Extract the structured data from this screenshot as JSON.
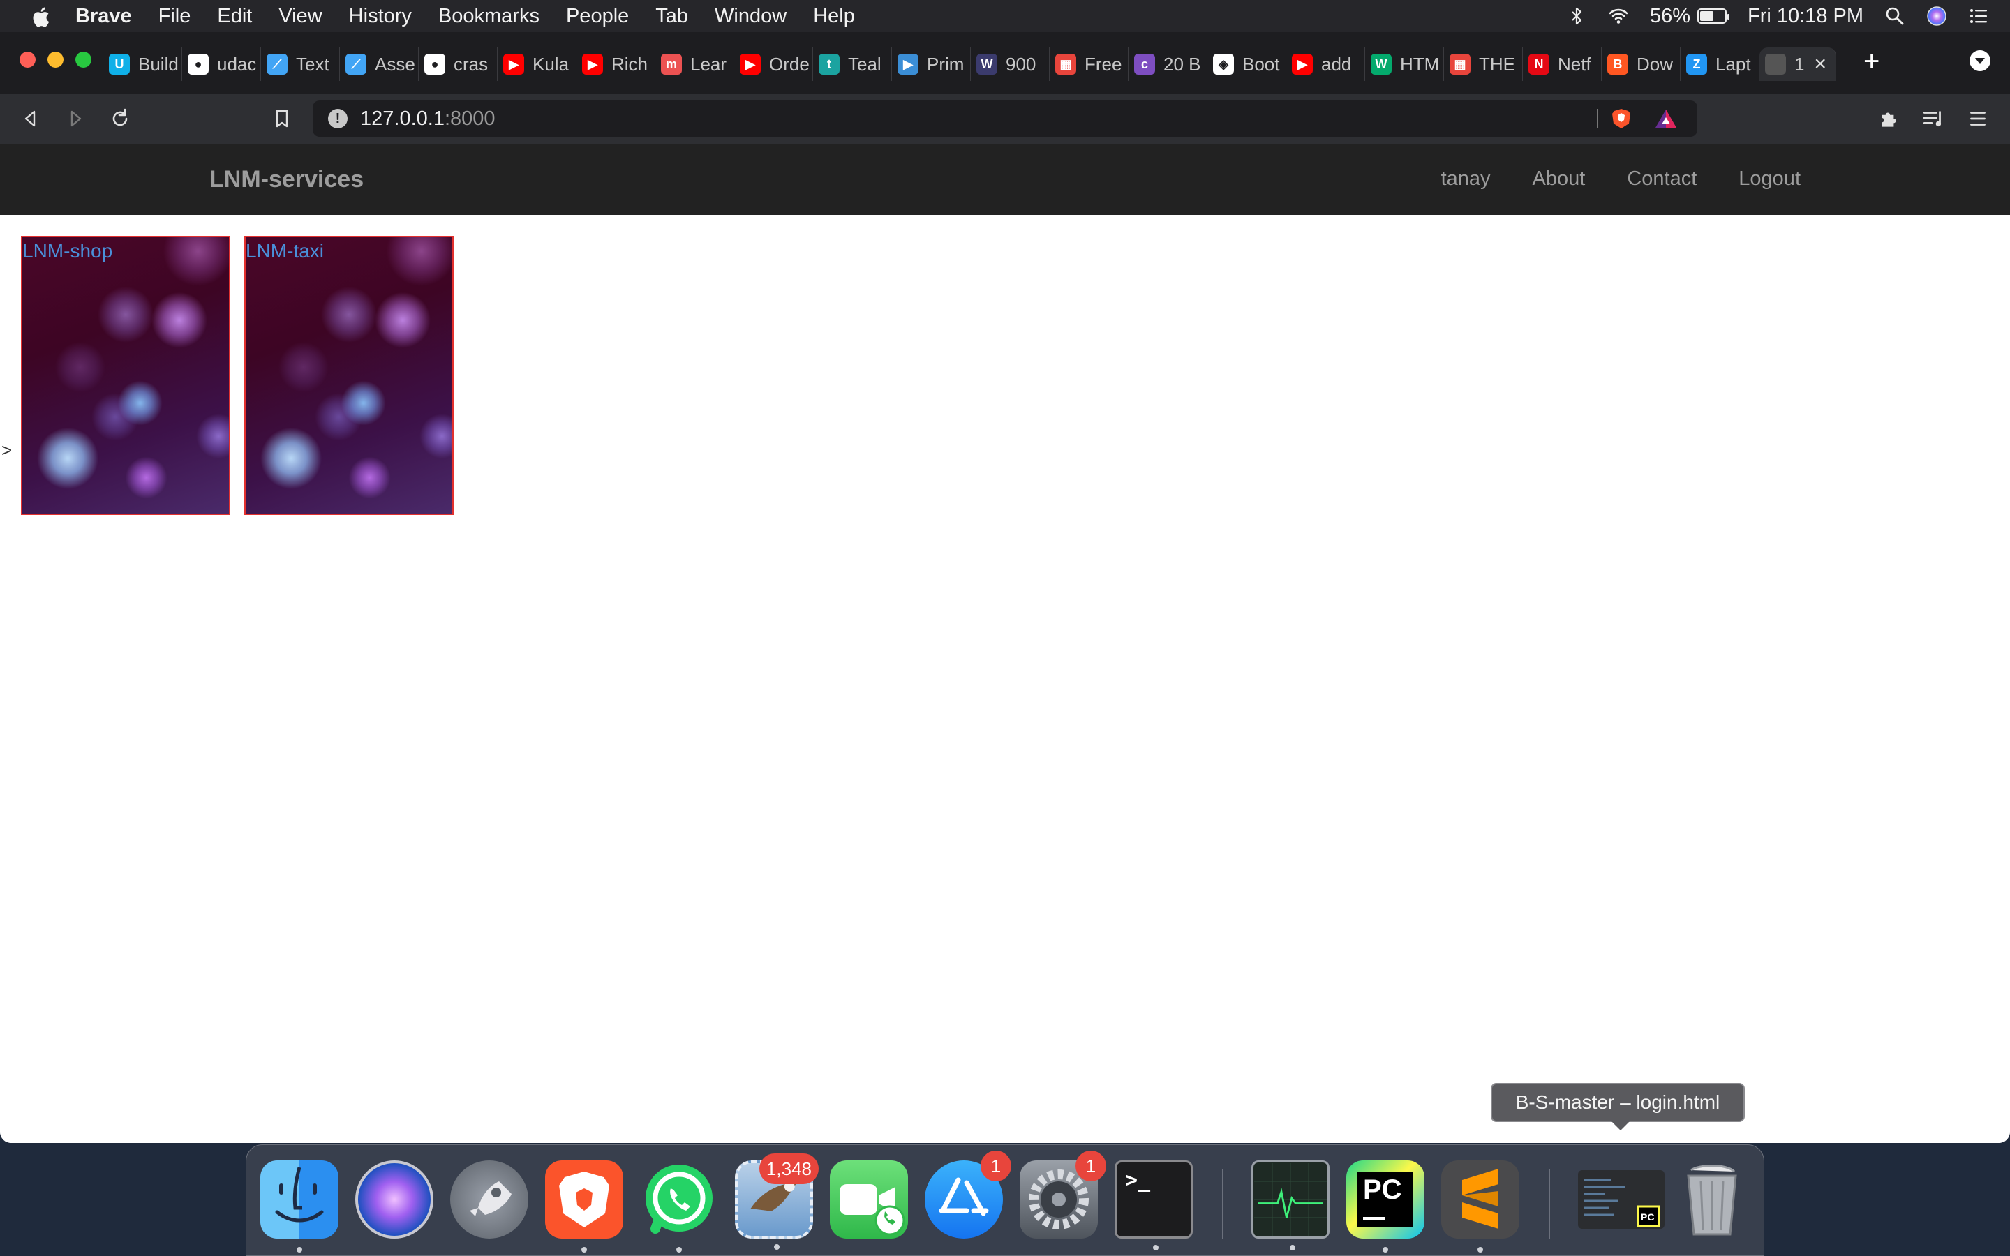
{
  "menubar": {
    "app_name": "Brave",
    "items": [
      "File",
      "Edit",
      "View",
      "History",
      "Bookmarks",
      "People",
      "Tab",
      "Window",
      "Help"
    ],
    "battery_percent": "56%",
    "clock": "Fri 10:18 PM"
  },
  "tabs": [
    {
      "title": "Build",
      "favicon": "udacity-icon",
      "color": "#0fb0e8"
    },
    {
      "title": "udac",
      "favicon": "github-icon",
      "color": "#ffffff"
    },
    {
      "title": "Text",
      "favicon": "flutter-icon",
      "color": "#42a5f5"
    },
    {
      "title": "Asse",
      "favicon": "flutter-icon",
      "color": "#42a5f5"
    },
    {
      "title": "cras",
      "favicon": "github-icon",
      "color": "#ffffff"
    },
    {
      "title": "Kula",
      "favicon": "youtube-icon",
      "color": "#ff0000"
    },
    {
      "title": "Rich",
      "favicon": "youtube-icon",
      "color": "#ff0000"
    },
    {
      "title": "Lear",
      "favicon": "udemy-icon",
      "color": "#ec5252"
    },
    {
      "title": "Orde",
      "favicon": "youtube-icon",
      "color": "#ff0000"
    },
    {
      "title": "Teal",
      "favicon": "teal-t-icon",
      "color": "#1ba3a0"
    },
    {
      "title": "Prim",
      "favicon": "play-circle-icon",
      "color": "#3b8ed6"
    },
    {
      "title": "900",
      "favicon": "w3-icon",
      "color": "#3b3b6d"
    },
    {
      "title": "Free",
      "favicon": "grid-icon",
      "color": "#e8453c"
    },
    {
      "title": "20 B",
      "favicon": "colorlib-icon",
      "color": "#7e4ec1"
    },
    {
      "title": "Boot",
      "favicon": "codepen-icon",
      "color": "#ffffff"
    },
    {
      "title": "add",
      "favicon": "youtube-icon",
      "color": "#ff0000"
    },
    {
      "title": "HTM",
      "favicon": "w3schools-icon",
      "color": "#04aa6d"
    },
    {
      "title": "THE",
      "favicon": "grid-icon",
      "color": "#e8453c"
    },
    {
      "title": "Netf",
      "favicon": "netflix-icon",
      "color": "#e50914"
    },
    {
      "title": "Dow",
      "favicon": "blogger-icon",
      "color": "#ff5722"
    },
    {
      "title": "Lapt",
      "favicon": "zeplin-icon",
      "color": "#2196f3"
    }
  ],
  "active_tab": {
    "title": "1",
    "favicon": "globe-icon"
  },
  "address_bar": {
    "host": "127.0.0.1",
    "port": ":8000"
  },
  "site": {
    "brand": "LNM-services",
    "nav": [
      "tanay",
      "About",
      "Contact",
      "Logout"
    ],
    "cards": [
      {
        "title": "LNM-shop"
      },
      {
        "title": "LNM-taxi"
      }
    ],
    "stray_text": ">"
  },
  "tooltip": "B-S-master – login.html",
  "dock": {
    "apps": [
      {
        "name": "Finder",
        "icon": "finder-icon",
        "running": true
      },
      {
        "name": "Siri",
        "icon": "siri-icon",
        "running": false
      },
      {
        "name": "Launchpad",
        "icon": "launchpad-icon",
        "running": false
      },
      {
        "name": "Brave",
        "icon": "brave-icon",
        "running": true
      },
      {
        "name": "WhatsApp",
        "icon": "whatsapp-icon",
        "running": true
      },
      {
        "name": "Mail",
        "icon": "mail-icon",
        "running": true,
        "badge": "1,348"
      },
      {
        "name": "FaceTime",
        "icon": "facetime-icon",
        "running": false
      },
      {
        "name": "App Store",
        "icon": "app-store-icon",
        "running": false,
        "badge": "1"
      },
      {
        "name": "System Preferences",
        "icon": "system-preferences-icon",
        "running": false,
        "badge": "1"
      },
      {
        "name": "Terminal",
        "icon": "terminal-icon",
        "running": true
      },
      {
        "name": "Activity Monitor",
        "icon": "activity-monitor-icon",
        "running": true
      },
      {
        "name": "PyCharm",
        "icon": "pycharm-icon",
        "running": true
      },
      {
        "name": "Sublime Text",
        "icon": "sublime-icon",
        "running": true
      },
      {
        "name": "Minimized window",
        "icon": "minimized-window-icon",
        "running": false
      },
      {
        "name": "Trash",
        "icon": "trash-icon",
        "running": false
      }
    ]
  }
}
